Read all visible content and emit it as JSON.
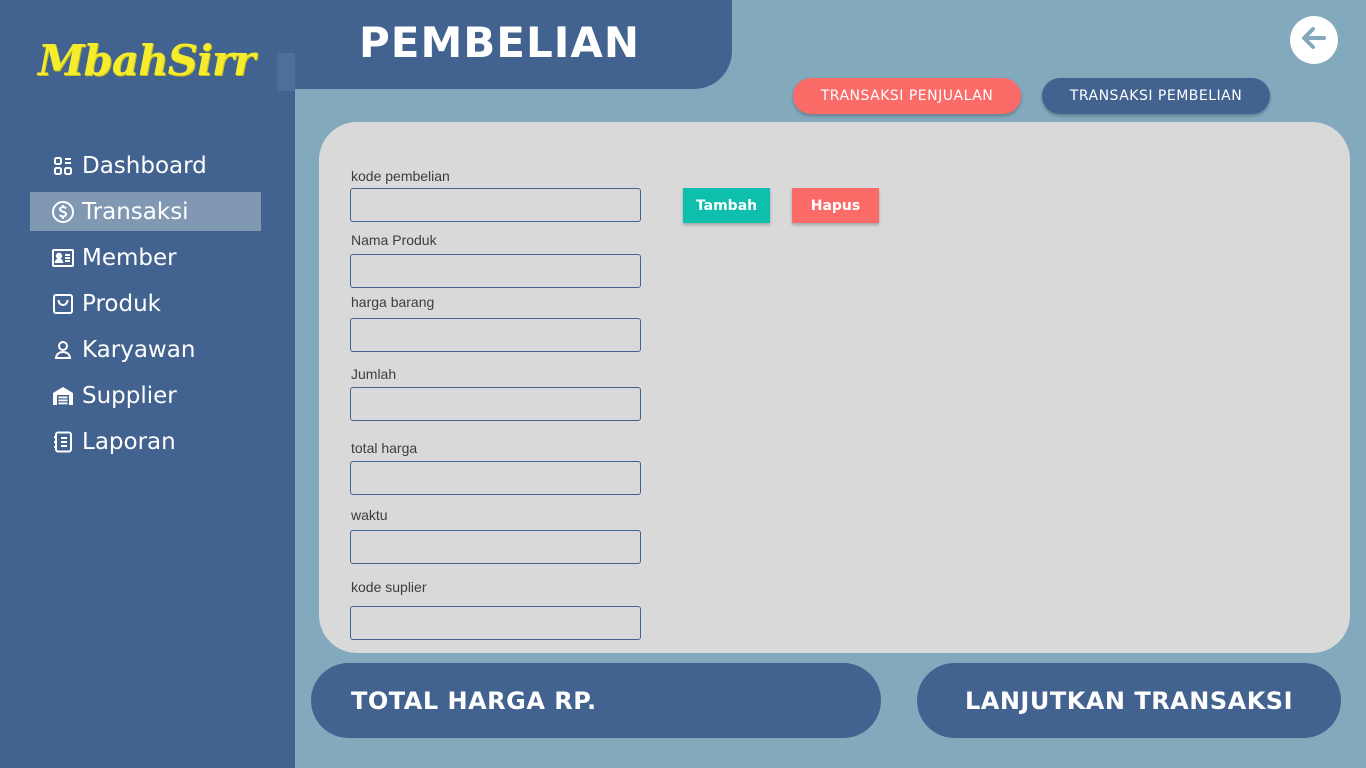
{
  "app": {
    "logo_text": "MbahSirr",
    "page_title": "PEMBELIAN"
  },
  "sidebar": {
    "items": [
      {
        "label": "Dashboard",
        "icon": "dashboard-icon",
        "active": false
      },
      {
        "label": "Transaksi",
        "icon": "dollar-circle-icon",
        "active": true
      },
      {
        "label": "Member",
        "icon": "member-card-icon",
        "active": false
      },
      {
        "label": "Produk",
        "icon": "shopping-bag-icon",
        "active": false
      },
      {
        "label": "Karyawan",
        "icon": "user-icon",
        "active": false
      },
      {
        "label": "Supplier",
        "icon": "warehouse-icon",
        "active": false
      },
      {
        "label": "Laporan",
        "icon": "report-icon",
        "active": false
      }
    ]
  },
  "tabs": {
    "penjualan": "TRANSAKSI PENJUALAN",
    "pembelian": "TRANSAKSI PEMBELIAN"
  },
  "form": {
    "fields": [
      {
        "label": "kode pembelian",
        "value": ""
      },
      {
        "label": "Nama Produk",
        "value": ""
      },
      {
        "label": "harga barang",
        "value": ""
      },
      {
        "label": "Jumlah",
        "value": ""
      },
      {
        "label": "total harga",
        "value": ""
      },
      {
        "label": "waktu",
        "value": ""
      },
      {
        "label": "kode suplier",
        "value": ""
      }
    ]
  },
  "actions": {
    "tambah": "Tambah",
    "hapus": "Hapus"
  },
  "footer": {
    "total_label": "TOTAL HARGA RP.",
    "next_label": "LANJUTKAN TRANSAKSI"
  },
  "colors": {
    "sidebar": "#42628f",
    "background": "#82a9bc",
    "card": "#d9d9d9",
    "accent_red": "#fb6b68",
    "accent_teal": "#0fbfae",
    "logo": "#f5ec2e"
  }
}
